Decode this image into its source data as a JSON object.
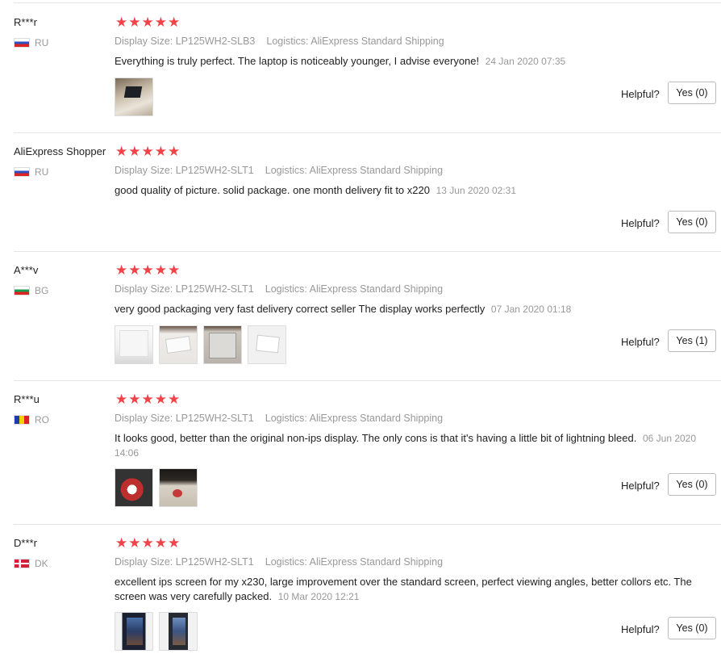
{
  "helpful_label": "Helpful?",
  "reviews": [
    {
      "user": "R***r",
      "country": "RU",
      "flag": "ru",
      "display_size": "Display Size: LP125WH2-SLB3",
      "logistics": "Logistics: AliExpress Standard Shipping",
      "content": "Everything is truly perfect. The laptop is noticeably younger, I advise everyone!",
      "date": "24 Jan 2020 07:35",
      "stars": 5,
      "yes_label": "Yes (0)"
    },
    {
      "user": "AliExpress Shopper",
      "country": "RU",
      "flag": "ru",
      "display_size": "Display Size: LP125WH2-SLT1",
      "logistics": "Logistics: AliExpress Standard Shipping",
      "content": "good quality of picture. solid package. one month delivery fit to x220",
      "date": "13 Jun 2020 02:31",
      "stars": 5,
      "yes_label": "Yes (0)"
    },
    {
      "user": "A***v",
      "country": "BG",
      "flag": "bg",
      "display_size": "Display Size: LP125WH2-SLT1",
      "logistics": "Logistics: AliExpress Standard Shipping",
      "content": "very good packaging very fast delivery correct seller The display works perfectly",
      "date": "07 Jan 2020 01:18",
      "stars": 5,
      "yes_label": "Yes (1)"
    },
    {
      "user": "R***u",
      "country": "RO",
      "flag": "ro",
      "display_size": "Display Size: LP125WH2-SLT1",
      "logistics": "Logistics: AliExpress Standard Shipping",
      "content": "It looks good, better than the original non-ips display. The only cons is that it's having a little bit of lightning bleed.",
      "date": "06 Jun 2020 14:06",
      "stars": 5,
      "yes_label": "Yes (0)"
    },
    {
      "user": "D***r",
      "country": "DK",
      "flag": "dk",
      "display_size": "Display Size: LP125WH2-SLT1",
      "logistics": "Logistics: AliExpress Standard Shipping",
      "content": "excellent ips screen for my x230, large improvement over the standard screen, perfect viewing angles, better collors etc. The screen was very carefully packed.",
      "date": "10 Mar 2020 12:21",
      "stars": 5,
      "yes_label": "Yes (0)"
    }
  ]
}
